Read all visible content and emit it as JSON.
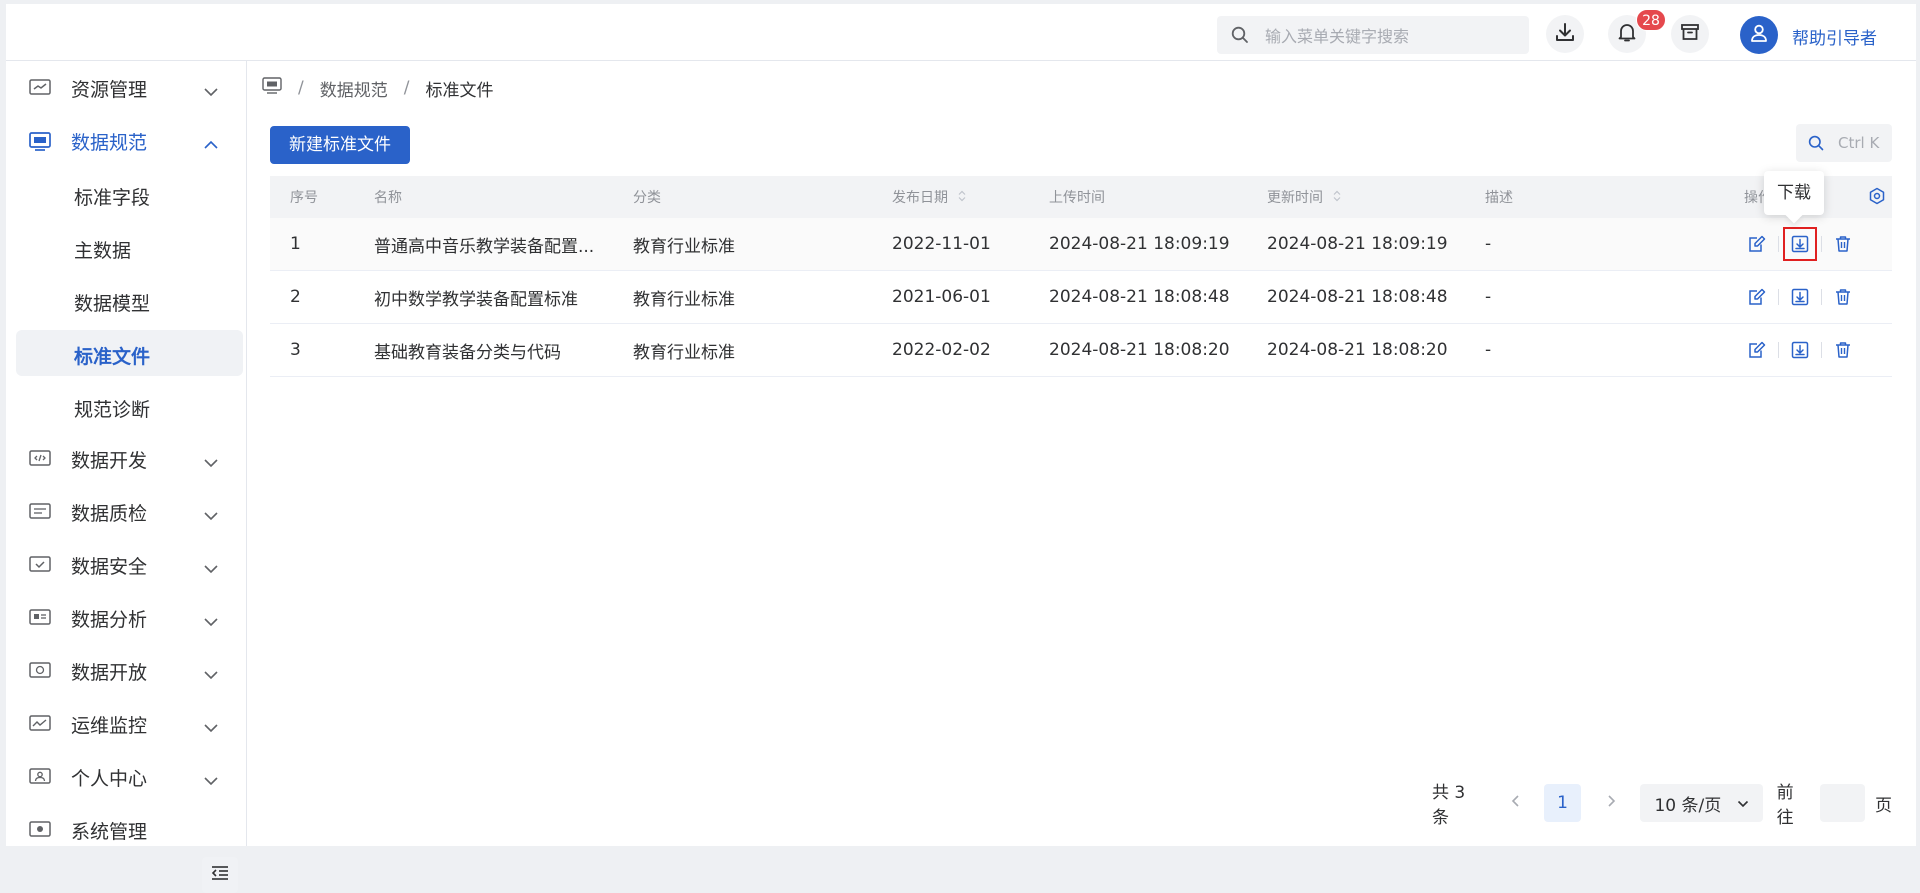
{
  "topbar": {
    "search_placeholder": "输入菜单关键字搜索",
    "notification_count": "28",
    "username": "帮助引导者"
  },
  "sidebar": {
    "items": [
      {
        "label": "资源管理",
        "icon": "resource-icon",
        "expanded": false
      },
      {
        "label": "数据规范",
        "icon": "data-spec-icon",
        "expanded": true,
        "children": [
          "标准字段",
          "主数据",
          "数据模型",
          "标准文件",
          "规范诊断"
        ],
        "active_child": "标准文件"
      },
      {
        "label": "数据开发",
        "icon": "code-icon",
        "expanded": false
      },
      {
        "label": "数据质检",
        "icon": "quality-icon",
        "expanded": false
      },
      {
        "label": "数据安全",
        "icon": "security-icon",
        "expanded": false
      },
      {
        "label": "数据分析",
        "icon": "analysis-icon",
        "expanded": false
      },
      {
        "label": "数据开放",
        "icon": "open-data-icon",
        "expanded": false
      },
      {
        "label": "运维监控",
        "icon": "monitor-icon",
        "expanded": false
      },
      {
        "label": "个人中心",
        "icon": "user-center-icon",
        "expanded": false
      },
      {
        "label": "系统管理",
        "icon": "system-icon",
        "expanded": false
      }
    ]
  },
  "breadcrumb": [
    "数据规范",
    "标准文件"
  ],
  "toolbar": {
    "new_button": "新建标准文件",
    "shortcut": "Ctrl K"
  },
  "table": {
    "headers": [
      "序号",
      "名称",
      "分类",
      "发布日期",
      "上传时间",
      "更新时间",
      "描述",
      "操作"
    ],
    "rows": [
      {
        "no": "1",
        "name": "普通高中音乐教学装备配置...",
        "category": "教育行业标准",
        "publish_date": "2022-11-01",
        "upload_time": "2024-08-21 18:09:19",
        "update_time": "2024-08-21 18:09:19",
        "desc": "-"
      },
      {
        "no": "2",
        "name": "初中数学教学装备配置标准",
        "category": "教育行业标准",
        "publish_date": "2021-06-01",
        "upload_time": "2024-08-21 18:08:48",
        "update_time": "2024-08-21 18:08:48",
        "desc": "-"
      },
      {
        "no": "3",
        "name": "基础教育装备分类与代码",
        "category": "教育行业标准",
        "publish_date": "2022-02-02",
        "upload_time": "2024-08-21 18:08:20",
        "update_time": "2024-08-21 18:08:20",
        "desc": "-"
      }
    ],
    "tooltip": "下载"
  },
  "pagination": {
    "total": "共 3 条",
    "current_page": "1",
    "page_size": "10 条/页",
    "goto_label": "前往",
    "page_suffix": "页"
  },
  "colors": {
    "primary": "#2a62c9",
    "badge": "#e5484d",
    "highlight": "#e02020"
  }
}
